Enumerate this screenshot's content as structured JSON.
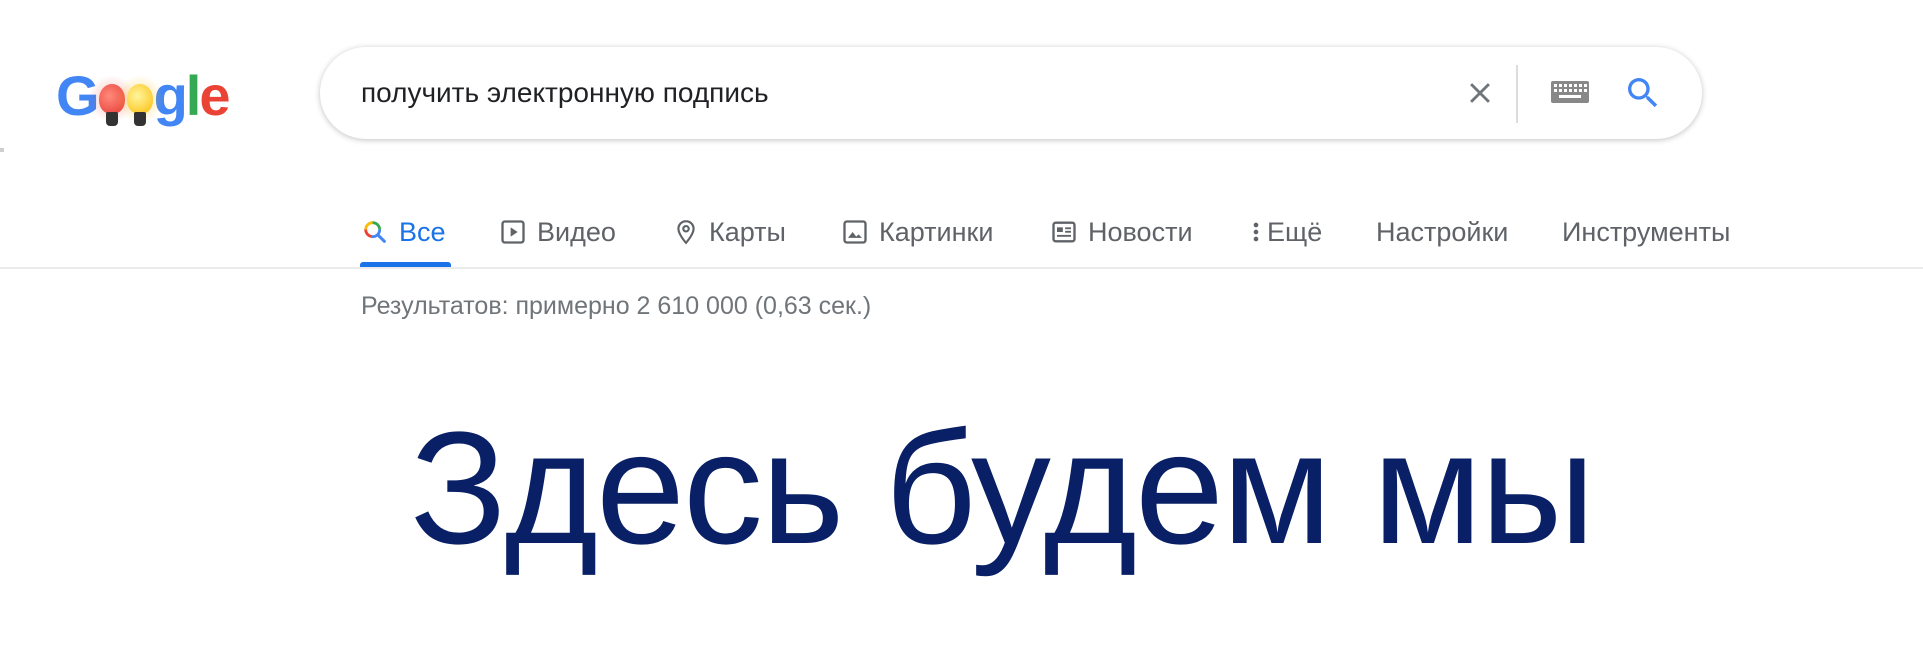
{
  "logo": {
    "text_g": "G",
    "text_g2": "g",
    "text_l": "l",
    "text_e": "e",
    "colors": {
      "blue": "#4285F4",
      "red": "#EA4335",
      "yellow": "#FBBC05",
      "green": "#34A853"
    }
  },
  "search": {
    "query": "получить электронную подпись",
    "clear_icon": "close-icon",
    "keyboard_icon": "keyboard-icon",
    "search_icon": "search-icon"
  },
  "tabs": [
    {
      "label": "Все",
      "icon": "search-multicolor-icon",
      "active": true
    },
    {
      "label": "Видео",
      "icon": "video-icon"
    },
    {
      "label": "Карты",
      "icon": "map-pin-icon"
    },
    {
      "label": "Картинки",
      "icon": "image-icon"
    },
    {
      "label": "Новости",
      "icon": "news-icon"
    },
    {
      "label": "Ещё",
      "icon": "more-vert-icon"
    },
    {
      "label": "Настройки"
    },
    {
      "label": "Инструменты"
    }
  ],
  "results": {
    "stats": "Результатов: примерно 2 610 000 (0,63 сек.)"
  },
  "banner": {
    "text": "Здесь будем мы"
  },
  "colors": {
    "accent": "#1a73e8",
    "banner": "#0a2066",
    "muted": "#5f6368"
  }
}
